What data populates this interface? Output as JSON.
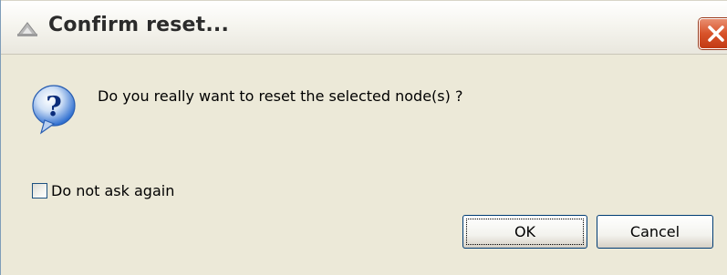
{
  "window": {
    "title": "Confirm reset..."
  },
  "dialog": {
    "message": "Do you really want to reset the selected node(s) ?",
    "checkbox": {
      "label": "Do not ask again",
      "checked": false
    },
    "buttons": {
      "ok_label": "OK",
      "cancel_label": "Cancel"
    }
  },
  "icons": {
    "title_icon": "app-icon",
    "close_icon": "close-icon",
    "question_icon": "question-icon"
  },
  "colors": {
    "close_button": "#d8532a",
    "question_bubble": "#2f6fd0",
    "dialog_background": "#ece9d8"
  }
}
